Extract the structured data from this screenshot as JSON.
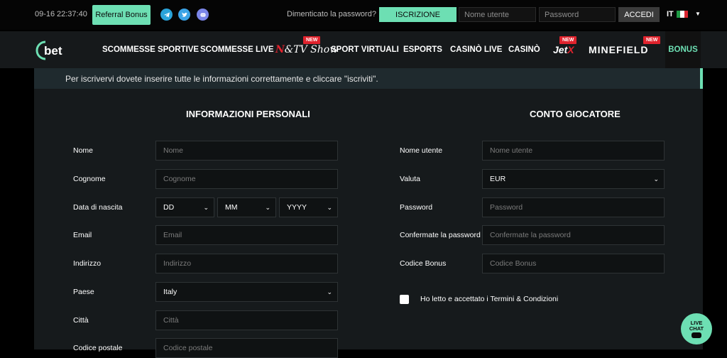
{
  "topbar": {
    "date": "09-16",
    "time": "22:37:40",
    "referral_label": "Referral Bonus",
    "social_icons": [
      "telegram-icon",
      "twitter-icon",
      "discord-icon"
    ],
    "forgot_password": "Dimenticato la password?",
    "signup_label": "ISCRIZIONE",
    "username_placeholder": "Nome utente",
    "password_placeholder": "Password",
    "login_label": "ACCEDI",
    "language": "IT"
  },
  "nav": {
    "logo_text": "bet",
    "items": [
      "SCOMMESSE SPORTIVE",
      "SCOMMESSE LIVE",
      "SPORT VIRTUALI",
      "ESPORTS",
      "CASINÒ LIVE",
      "CASINÒ"
    ],
    "ntv_show": {
      "n": "N",
      "rest": "&TV Show"
    },
    "jetx": {
      "jet": "Jet",
      "x": "X"
    },
    "minefield": "MINEFIELD",
    "new_badge": "NEW",
    "bonus_label": "BONUS"
  },
  "banner": {
    "text": "Per iscrivervi dovete inserire tutte le informazioni correttamente e cliccare \"iscriviti\"."
  },
  "personal": {
    "title": "INFORMAZIONI PERSONALI",
    "first_name": {
      "label": "Nome",
      "placeholder": "Nome"
    },
    "last_name": {
      "label": "Cognome",
      "placeholder": "Cognome"
    },
    "birth": {
      "label": "Data di nascita",
      "day": "DD",
      "month": "MM",
      "year": "YYYY"
    },
    "email": {
      "label": "Email",
      "placeholder": "Email"
    },
    "address": {
      "label": "Indirizzo",
      "placeholder": "Indirizzo"
    },
    "country": {
      "label": "Paese",
      "value": "Italy"
    },
    "city": {
      "label": "Città",
      "placeholder": "Città"
    },
    "postal": {
      "label": "Codice postale",
      "placeholder": "Codice postale"
    }
  },
  "account": {
    "title": "CONTO GIOCATORE",
    "username": {
      "label": "Nome utente",
      "placeholder": "Nome utente"
    },
    "currency": {
      "label": "Valuta",
      "value": "EUR"
    },
    "password": {
      "label": "Password",
      "placeholder": "Password"
    },
    "confirm_password": {
      "label": "Confermate la password",
      "placeholder": "Confermate la password"
    },
    "bonus_code": {
      "label": "Codice Bonus",
      "placeholder": "Codice Bonus"
    },
    "terms": "Ho letto e accettato i Termini & Condizioni"
  },
  "livechat": {
    "line1": "LIVE",
    "line2": "CHAT"
  },
  "colors": {
    "accent": "#6ddfb3",
    "badge": "#e0232d",
    "panel": "#161a1c"
  }
}
